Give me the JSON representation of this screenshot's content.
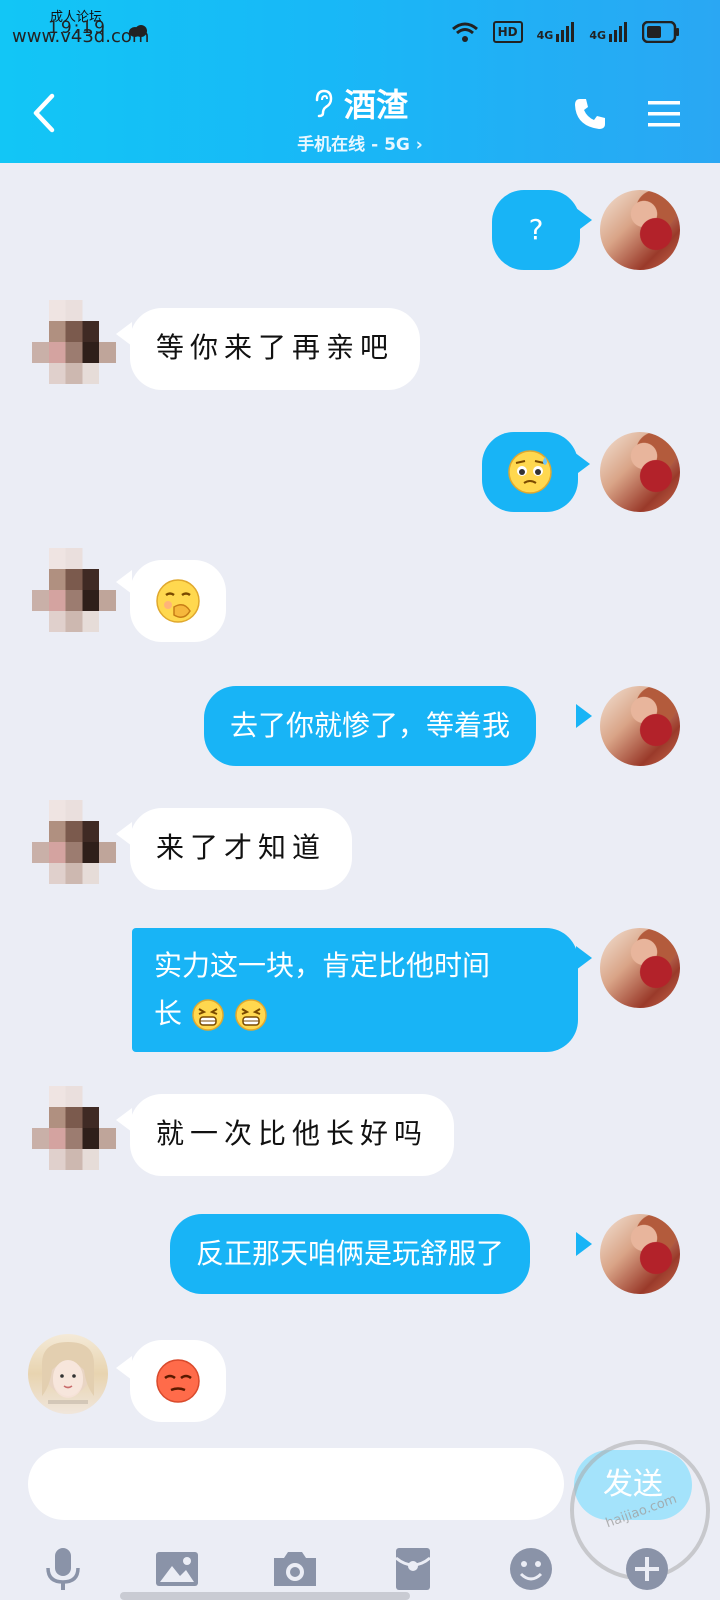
{
  "statusbar": {
    "watermark_top": "成人论坛",
    "watermark_site": "www.v43d.com",
    "time": "19:19",
    "hd": "HD",
    "net1": "4G",
    "net2": "4G"
  },
  "header": {
    "title": "酒渣",
    "subtitle": "手机在线 - 5G ›"
  },
  "messages": [
    {
      "side": "out",
      "text": "?"
    },
    {
      "side": "in",
      "text": "等你来了再亲吧"
    },
    {
      "side": "out",
      "emoji": "worried-sweat-face"
    },
    {
      "side": "in",
      "emoji": "covering-mouth-face"
    },
    {
      "side": "out",
      "text": "去了你就惨了，等着我"
    },
    {
      "side": "in",
      "text": "来了才知道"
    },
    {
      "side": "out",
      "text_line1": "实力这一块，肯定比他时间",
      "text_line2": "长"
    },
    {
      "side": "in",
      "text": "就一次比他长好吗"
    },
    {
      "side": "out",
      "text": "反正那天咱俩是玩舒服了"
    },
    {
      "side": "in",
      "emoji": "rolling-eyes-face"
    }
  ],
  "input": {
    "send_label": "发送",
    "watermark": "haijiao.com"
  },
  "colors": {
    "header_start": "#12c6f6",
    "header_end": "#2aa7f3",
    "bubble_out": "#18b4f6",
    "bubble_in": "#ffffff",
    "background": "#ebedf5"
  }
}
